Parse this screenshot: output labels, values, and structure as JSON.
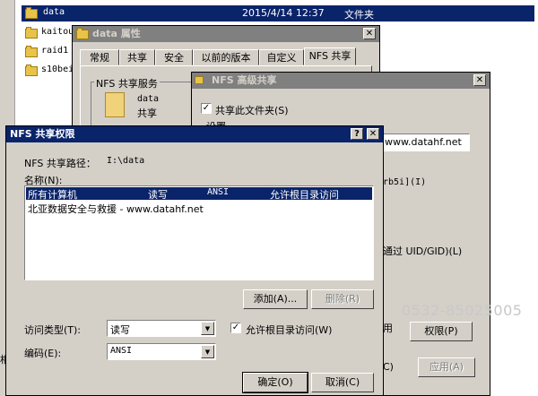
{
  "explorer": {
    "rows": [
      {
        "name": "data",
        "date": "2015/4/14 12:37",
        "type": "文件夹"
      },
      {
        "name": "kaitou"
      },
      {
        "name": "raid1"
      },
      {
        "name": "s10bei"
      }
    ]
  },
  "properties": {
    "title": "data 属性",
    "tabs": [
      "常规",
      "共享",
      "安全",
      "以前的版本",
      "自定义",
      "NFS 共享"
    ],
    "group_label": "NFS 共享服务",
    "folder_name": "data",
    "status": "共享"
  },
  "advanced": {
    "title": "NFS 高级共享",
    "share_checkbox": "共享此文件夹(S)",
    "settings_label": "设置",
    "share_name": "www.datahf.net",
    "krb_text": "rb5i](I)",
    "uid_text": "通过 UID/GID)(L)",
    "perm_btn_left": "用",
    "perm_btn": "权限(P)",
    "apply_btn_left": "C)",
    "apply_btn": "应用(A)"
  },
  "perms": {
    "title": "NFS 共享权限",
    "help": "?",
    "close": "✕",
    "path_label": "NFS 共享路径：",
    "path_value": "I:\\data",
    "names_label": "名称(N):",
    "rows": [
      {
        "name": "所有计算机",
        "access": "读写",
        "encoding": "ANSI",
        "root": "允许根目录访问"
      },
      {
        "name": "北亚数据安全与救援 - www.datahf.net",
        "access": "",
        "encoding": "",
        "root": ""
      }
    ],
    "add_btn": "添加(A)...",
    "remove_btn": "删除(R)",
    "access_label": "访问类型(T):",
    "access_value": "读写",
    "root_checkbox": "允许根目录访问(W)",
    "encoding_label": "编码(E):",
    "encoding_value": "ANSI",
    "ok_btn": "确定(O)",
    "cancel_btn": "取消(C)",
    "watermark": "0532-85025005"
  },
  "background_fragments": {
    "bottom_left": "相"
  },
  "colors": {
    "active_title": "#0a246a",
    "selection": "#0a246a",
    "dialog_bg": "#d4d0c8"
  }
}
